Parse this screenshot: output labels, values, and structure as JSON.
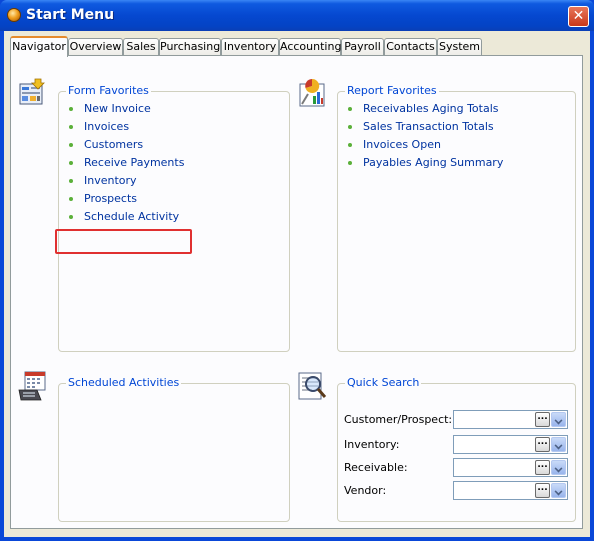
{
  "window": {
    "title": "Start Menu",
    "close_glyph": "✕"
  },
  "tabs": [
    {
      "label": "Navigator",
      "active": true
    },
    {
      "label": "Overview"
    },
    {
      "label": "Sales"
    },
    {
      "label": "Purchasing"
    },
    {
      "label": "Inventory"
    },
    {
      "label": "Accounting"
    },
    {
      "label": "Payroll"
    },
    {
      "label": "Contacts"
    },
    {
      "label": "System"
    }
  ],
  "form_favorites": {
    "label": "Form Favorites",
    "icon": "form-favorites-icon",
    "items": [
      "New Invoice",
      "Invoices",
      "Customers",
      "Receive Payments",
      "Inventory",
      "Prospects",
      "Schedule Activity"
    ],
    "highlighted_item": "Schedule Activity"
  },
  "report_favorites": {
    "label": "Report Favorites",
    "icon": "report-favorites-icon",
    "items": [
      "Receivables Aging Totals",
      "Sales Transaction Totals",
      "Invoices Open",
      "Payables Aging Summary"
    ]
  },
  "scheduled_activities": {
    "label": "Scheduled Activities",
    "icon": "scheduled-activities-icon"
  },
  "quick_search": {
    "label": "Quick Search",
    "icon": "quick-search-icon",
    "fields": [
      {
        "label": "Customer/Prospect:",
        "value": ""
      },
      {
        "label": "Inventory:",
        "value": ""
      },
      {
        "label": "Receivable:",
        "value": ""
      },
      {
        "label": "Vendor:",
        "value": ""
      }
    ],
    "lookup_glyph": "..."
  },
  "colors": {
    "link": "#0033a0",
    "group_label": "#0046d5",
    "highlight": "#e03030",
    "bullet": "#5bb03a"
  }
}
